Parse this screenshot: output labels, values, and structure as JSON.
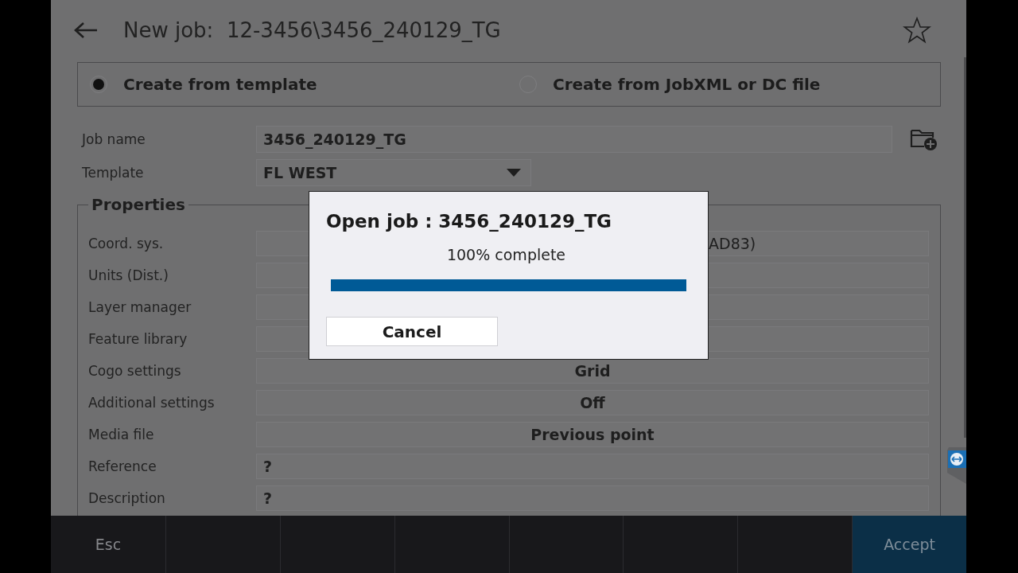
{
  "header": {
    "title": "New job:  12-3456\\3456_240129_TG"
  },
  "source_options": [
    {
      "label": "Create from template",
      "selected": true
    },
    {
      "label": "Create from JobXML or DC file",
      "selected": false
    }
  ],
  "job_name": {
    "label": "Job name",
    "value": "3456_240129_TG"
  },
  "template": {
    "label": "Template",
    "value": "FL WEST"
  },
  "properties": {
    "title": "Properties",
    "rows": [
      {
        "label": "Coord. sys.",
        "kind": "clipped",
        "value": "AD83)"
      },
      {
        "label": "Units (Dist.)",
        "kind": "empty"
      },
      {
        "label": "Layer manager",
        "kind": "empty"
      },
      {
        "label": "Feature library",
        "kind": "empty"
      },
      {
        "label": "Cogo settings",
        "kind": "choice",
        "value": "Grid"
      },
      {
        "label": "Additional settings",
        "kind": "choice",
        "value": "Off"
      },
      {
        "label": "Media file",
        "kind": "choice",
        "value": "Previous point"
      },
      {
        "label": "Reference",
        "kind": "text",
        "value": "?"
      },
      {
        "label": "Description",
        "kind": "text",
        "value": "?"
      }
    ]
  },
  "dialog": {
    "title": "Open job : 3456_240129_TG",
    "status": "100% complete",
    "level": 1,
    "cancel": "Cancel"
  },
  "softkeys": [
    {
      "kind": "plain",
      "label": "Esc"
    },
    {
      "kind": "blank"
    },
    {
      "kind": "blank"
    },
    {
      "kind": "blank"
    },
    {
      "kind": "blank"
    },
    {
      "kind": "blank"
    },
    {
      "kind": "blank"
    },
    {
      "kind": "primary",
      "label": "Accept"
    }
  ]
}
